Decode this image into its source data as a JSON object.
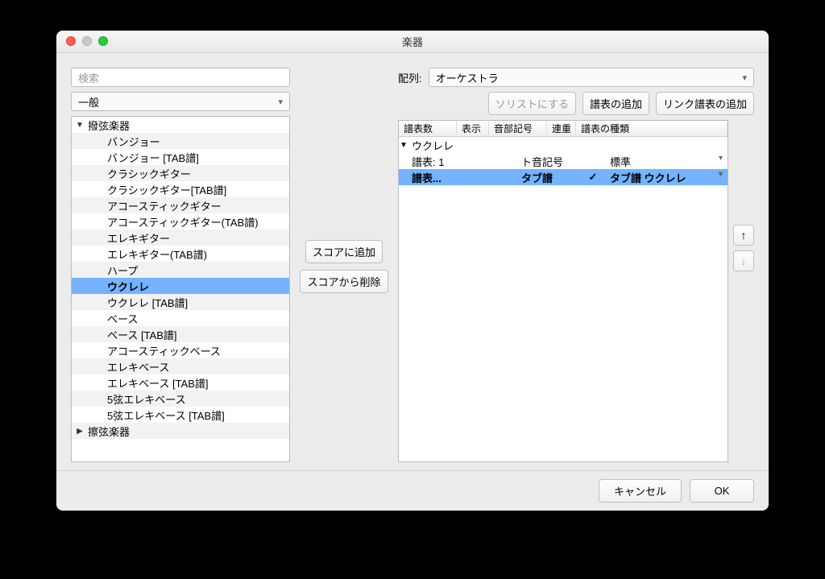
{
  "title": "楽器",
  "search_placeholder": "検索",
  "genre_label": "一般",
  "instr_groups": {
    "plucked": "撥弦楽器",
    "bowed": "擦弦楽器"
  },
  "instruments": [
    "バンジョー",
    "バンジョー [TAB譜]",
    "クラシックギター",
    "クラシックギター[TAB譜]",
    "アコースティックギター",
    "アコースティックギター(TAB譜)",
    "エレキギター",
    "エレキギター(TAB譜)",
    "ハープ",
    "ウクレレ",
    "ウクレレ [TAB譜]",
    "ベース",
    "ベース [TAB譜]",
    "アコースティックベース",
    "エレキベース",
    "エレキベース [TAB譜]",
    "5弦エレキベース",
    "5弦エレキベース [TAB譜]"
  ],
  "mid_buttons": {
    "add": "スコアに追加",
    "remove": "スコアから削除"
  },
  "arr_label": "配列:",
  "arr_value": "オーケストラ",
  "top_buttons": {
    "soloist": "ソリストにする",
    "add_staff": "譜表の追加",
    "add_linked": "リンク譜表の追加"
  },
  "staff_headers": {
    "count": "譜表数",
    "show": "表示",
    "clef": "音部記号",
    "link": "連重",
    "type": "譜表の種類"
  },
  "staff_root": "ウクレレ",
  "staff_rows": [
    {
      "name": "譜表: 1",
      "clef": "ト音記号",
      "check": "",
      "type": "標準"
    },
    {
      "name": "譜表...",
      "clef": "タブ譜",
      "check": "✓",
      "type": "タブ譜 ウクレレ"
    }
  ],
  "arrows": {
    "up": "↑",
    "down": "↓"
  },
  "footer": {
    "cancel": "キャンセル",
    "ok": "OK"
  }
}
